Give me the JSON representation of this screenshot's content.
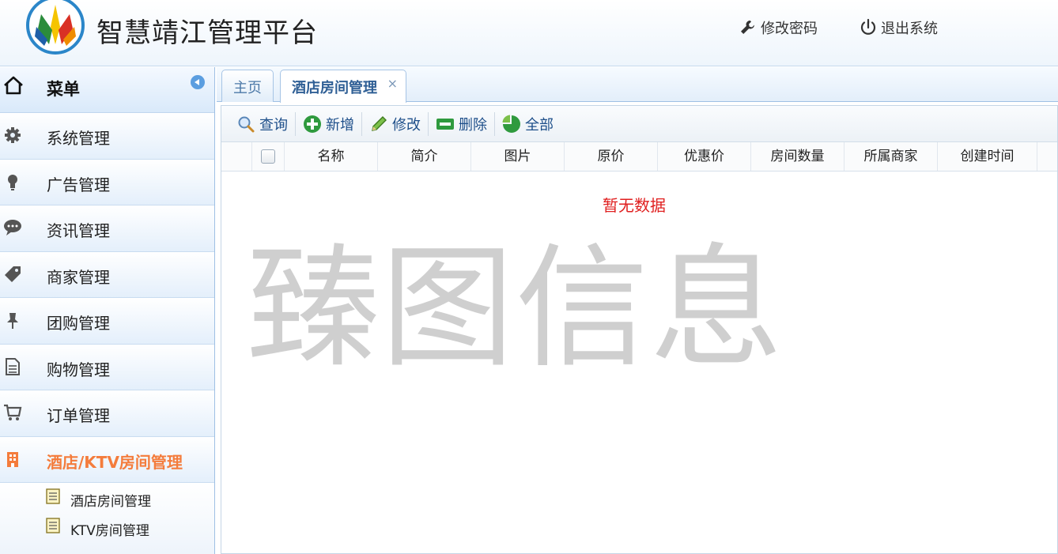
{
  "header": {
    "title": "智慧靖江管理平台",
    "change_password": "修改密码",
    "logout": "退出系统"
  },
  "sidebar": {
    "title": "菜单",
    "items": [
      {
        "label": "系统管理",
        "icon": "gear-icon"
      },
      {
        "label": "广告管理",
        "icon": "lightbulb-icon"
      },
      {
        "label": "资讯管理",
        "icon": "chat-bubble-icon"
      },
      {
        "label": "商家管理",
        "icon": "tag-icon"
      },
      {
        "label": "团购管理",
        "icon": "pin-icon"
      },
      {
        "label": "购物管理",
        "icon": "document-icon"
      },
      {
        "label": "订单管理",
        "icon": "cart-icon"
      },
      {
        "label": "酒店/KTV房间管理",
        "icon": "building-icon",
        "active": true
      }
    ],
    "subitems": [
      {
        "label": "酒店房间管理"
      },
      {
        "label": "KTV房间管理"
      }
    ]
  },
  "tabs": {
    "home": "主页",
    "current": "酒店房间管理",
    "close": "×"
  },
  "toolbar": {
    "query": "查询",
    "add": "新增",
    "edit": "修改",
    "delete": "删除",
    "all": "全部"
  },
  "table": {
    "columns": [
      "名称",
      "简介",
      "图片",
      "原价",
      "优惠价",
      "房间数量",
      "所属商家",
      "创建时间"
    ],
    "empty_text": "暂无数据"
  },
  "watermark": "臻图信息",
  "colors": {
    "accent": "#f47c3c",
    "link": "#1e4f8a",
    "empty": "#e02020"
  }
}
